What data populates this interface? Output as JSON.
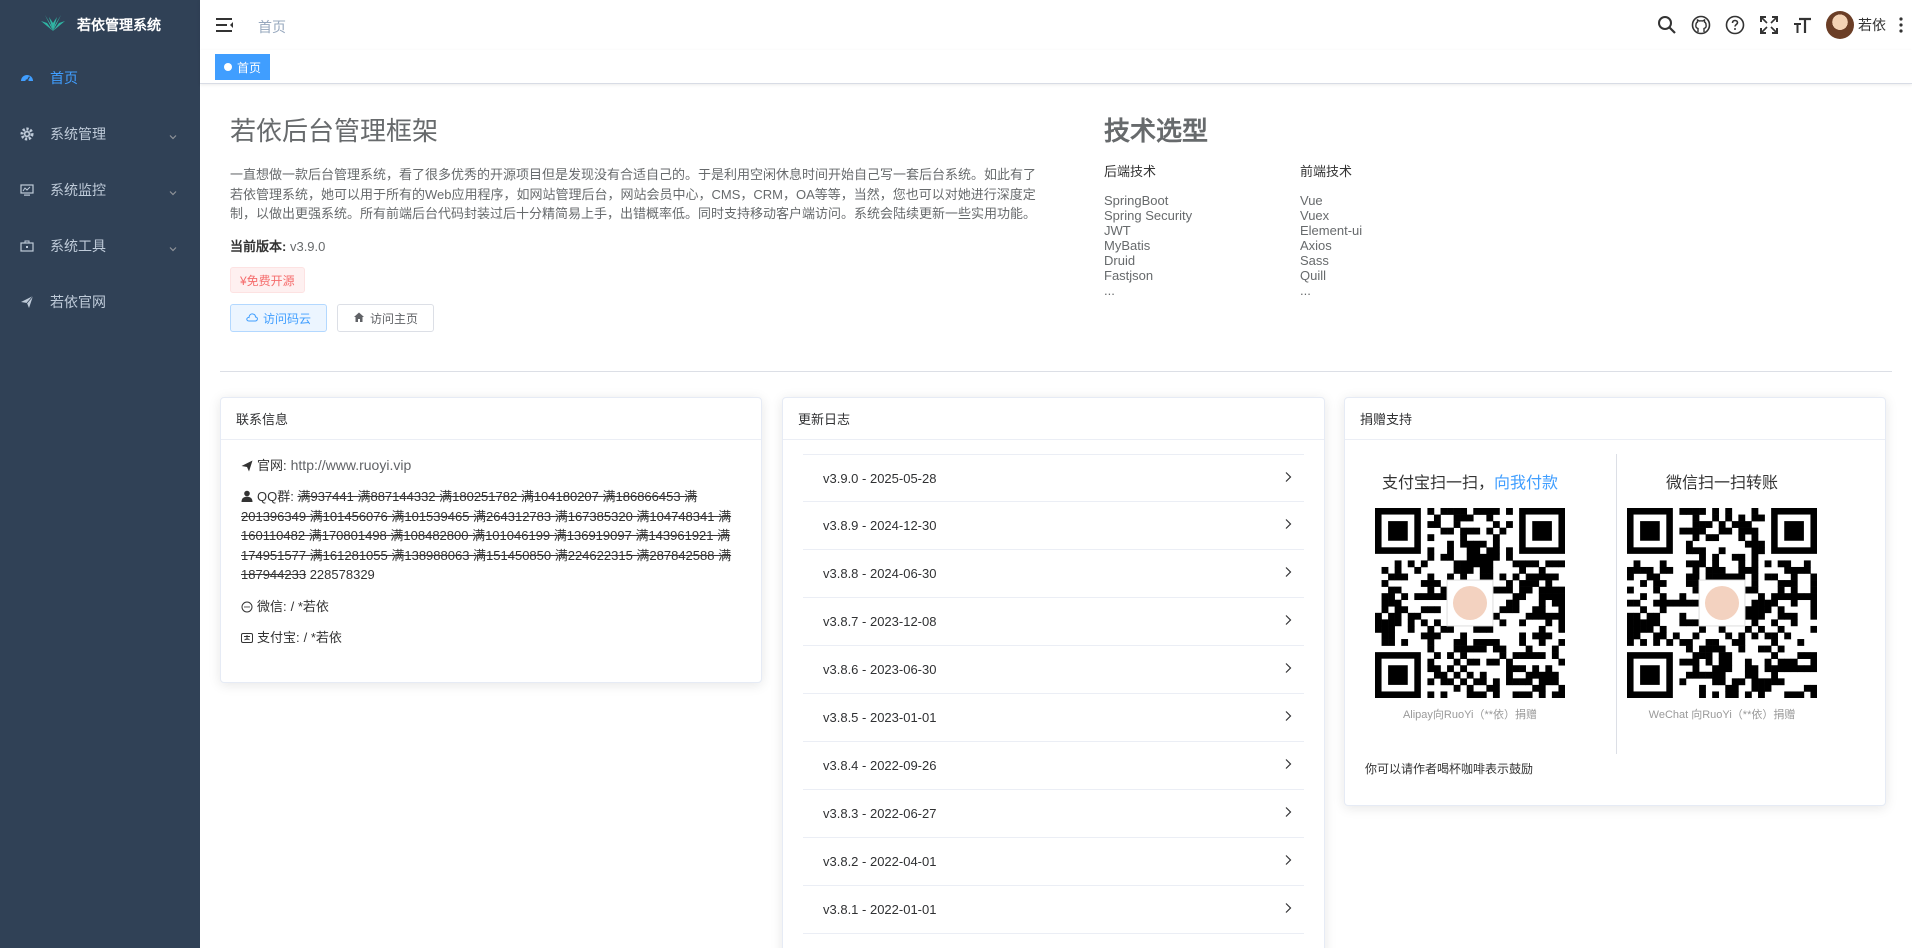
{
  "app": {
    "logo_title": "若依管理系统"
  },
  "sidebar": {
    "items": [
      {
        "label": "首页",
        "icon": "dashboard-icon",
        "active": true,
        "expandable": false
      },
      {
        "label": "系统管理",
        "icon": "gear-icon",
        "active": false,
        "expandable": true
      },
      {
        "label": "系统监控",
        "icon": "monitor-icon",
        "active": false,
        "expandable": true
      },
      {
        "label": "系统工具",
        "icon": "toolbox-icon",
        "active": false,
        "expandable": true
      },
      {
        "label": "若依官网",
        "icon": "send-icon",
        "active": false,
        "expandable": false
      }
    ]
  },
  "navbar": {
    "breadcrumb": "首页",
    "user_name": "若依",
    "icons": [
      "search-icon",
      "github-icon",
      "help-icon",
      "fullscreen-icon",
      "font-size-icon"
    ]
  },
  "tags": {
    "active_tag": "首页"
  },
  "intro": {
    "title": "若依后台管理框架",
    "text": "一直想做一款后台管理系统，看了很多优秀的开源项目但是发现没有合适自己的。于是利用空闲休息时间开始自己写一套后台系统。如此有了若依管理系统，她可以用于所有的Web应用程序，如网站管理后台，网站会员中心，CMS，CRM，OA等等，当然，您也可以对她进行深度定制，以做出更强系统。所有前端后台代码封装过后十分精简易上手，出错概率低。同时支持移动客户端访问。系统会陆续更新一些实用功能。",
    "version_label": "当前版本:",
    "version_value": "v3.9.0",
    "free_tag": "¥免费开源",
    "btn_cloud": "访问码云",
    "btn_home": "访问主页"
  },
  "tech": {
    "title": "技术选型",
    "backend_title": "后端技术",
    "backend": [
      "SpringBoot",
      "Spring Security",
      "JWT",
      "MyBatis",
      "Druid",
      "Fastjson",
      "..."
    ],
    "frontend_title": "前端技术",
    "frontend": [
      "Vue",
      "Vuex",
      "Element-ui",
      "Axios",
      "Sass",
      "Quill",
      "..."
    ]
  },
  "contact": {
    "title": "联系信息",
    "site_label": "官网:",
    "site_value": "http://www.ruoyi.vip",
    "qq_label": "QQ群:",
    "qq_struck": "满937441 满887144332 满180251782 满104180207 满186866453 满201396349 满101456076 满101539465 满264312783 满167385320 满104748341 满160110482 满170801498 满108482800 满101046199 满136919097 满143961921 满174951577 满161281055 满138988063 满151450850 满224622315 满287842588 满187944233",
    "qq_active": "228578329",
    "wechat_label": "微信:",
    "wechat_value": "/ *若依",
    "alipay_label": "支付宝:",
    "alipay_value": "/ *若依"
  },
  "changelog": {
    "title": "更新日志",
    "items": [
      "v3.9.0 - 2025-05-28",
      "v3.8.9 - 2024-12-30",
      "v3.8.8 - 2024-06-30",
      "v3.8.7 - 2023-12-08",
      "v3.8.6 - 2023-06-30",
      "v3.8.5 - 2023-01-01",
      "v3.8.4 - 2022-09-26",
      "v3.8.3 - 2022-06-27",
      "v3.8.2 - 2022-04-01",
      "v3.8.1 - 2022-01-01"
    ]
  },
  "donate": {
    "title": "捐赠支持",
    "alipay_heading": "支付宝扫一扫，",
    "alipay_heading_link": "向我付款",
    "alipay_caption": "Alipay向RuoYi（**依）捐赠",
    "wechat_heading": "微信扫一扫转账",
    "wechat_caption": "WeChat 向RuoYi（**依）捐赠",
    "note": "你可以请作者喝杯咖啡表示鼓励"
  },
  "colors": {
    "sidebar_bg": "#304156",
    "accent": "#409eff",
    "danger": "#f56c6c"
  }
}
